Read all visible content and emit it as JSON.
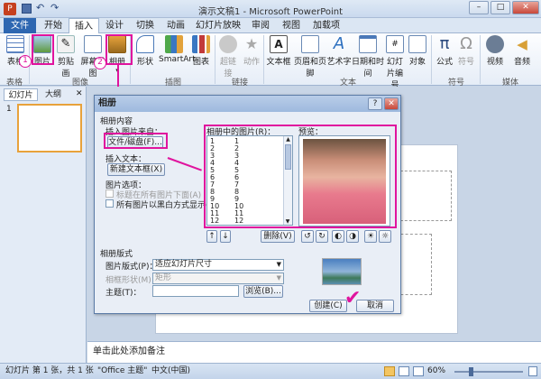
{
  "window": {
    "title": "演示文稿1 - Microsoft PowerPoint",
    "min": "–",
    "max": "□",
    "close": "✕"
  },
  "tabs": [
    "文件",
    "开始",
    "插入",
    "设计",
    "切换",
    "动画",
    "幻灯片放映",
    "审阅",
    "视图",
    "加载项"
  ],
  "ribbon": {
    "buttons": {
      "table": "表格",
      "picture": "图片",
      "clipart": "剪贴画",
      "screenshot": "屏幕截图",
      "album": "相册",
      "shapes": "形状",
      "smartart": "SmartArt",
      "chart": "图表",
      "hyperlink": "超链接",
      "action": "动作",
      "textbox": "文本框",
      "header_footer": "页眉和页脚",
      "wordart": "艺术字",
      "datetime": "日期和时间",
      "slide_number": "幻灯片编号",
      "object": "对象",
      "equation": "公式",
      "symbol": "符号",
      "video": "视频",
      "audio": "音频"
    },
    "groups": {
      "tables": "表格",
      "images": "图像",
      "illustrations": "插图",
      "links": "链接",
      "text": "文本",
      "symbols": "符号",
      "media": "媒体"
    },
    "callouts": [
      "1",
      "2"
    ]
  },
  "left_pane": {
    "tab_slides": "幻灯片",
    "tab_outline": "大纲",
    "slide_num": "1"
  },
  "dialog": {
    "title": "相册",
    "section_content": "相册内容",
    "insert_from": "插入图片来自：",
    "file_disk_button": "文件/磁盘(F)...",
    "insert_text": "插入文本：",
    "new_textbox_button": "新建文本框(X)",
    "picture_options": "图片选项：",
    "opt_captions": "标题在所有图片下面(A)",
    "opt_bw": "所有图片以黑白方式显示(K)",
    "pictures_in_album": "相册中的图片(R)：",
    "preview": "预览：",
    "list_col1": [
      "1",
      "2",
      "3",
      "4",
      "5",
      "6",
      "7",
      "8",
      "9",
      "10",
      "11",
      "12"
    ],
    "list_col2": [
      "1",
      "2",
      "3",
      "4",
      "5",
      "6",
      "7",
      "8",
      "9",
      "10",
      "11",
      "12"
    ],
    "delete_button": "删除(V)",
    "section_layout": "相册版式",
    "picture_layout_label": "图片版式(P)：",
    "picture_layout_value": "适应幻灯片尺寸",
    "frame_shape_label": "相框形状(M)：",
    "frame_shape_value": "矩形",
    "theme_label": "主题(T)：",
    "theme_value": "",
    "browse_button": "浏览(B)...",
    "create_button": "创建(C)",
    "cancel_button": "取消",
    "help": "?",
    "close": "✕"
  },
  "notes": "单击此处添加备注",
  "status": {
    "slide_info": "幻灯片 第 1 张，共 1 张",
    "theme": "\"Office 主题\"",
    "language": "中文(中国)",
    "zoom": "60%"
  },
  "colors": {
    "accent": "#e0149e",
    "file_tab": "#2e67b1"
  }
}
